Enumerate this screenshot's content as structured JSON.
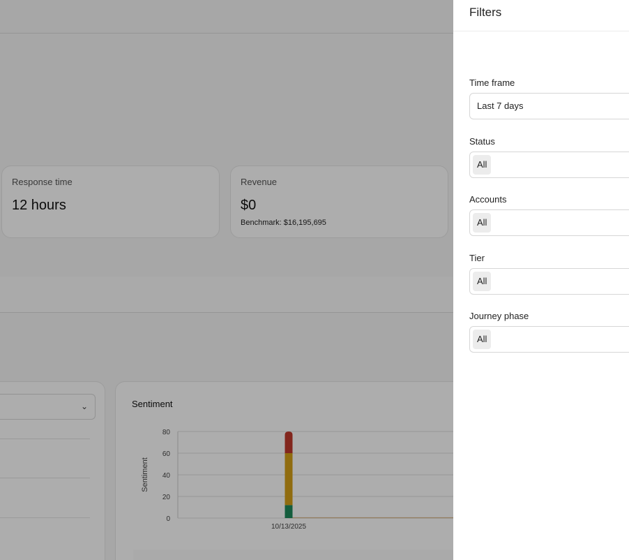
{
  "background": {
    "cards": [
      {
        "title": "Response time",
        "value": "12 hours",
        "sub": ""
      },
      {
        "title": "Revenue",
        "value": "$0",
        "sub": "Benchmark: $16,195,695"
      }
    ],
    "sentiment_chart": {
      "title": "Sentiment",
      "ylabel": "Sentiment"
    }
  },
  "chart_data": {
    "type": "bar",
    "title": "Sentiment",
    "ylabel": "Sentiment",
    "categories": [
      "10/13/2025"
    ],
    "ylim": [
      0,
      80
    ],
    "yticks": [
      "0",
      "20",
      "40",
      "60",
      "80"
    ],
    "stacked": true,
    "series": [
      {
        "color": "#1e8a5a",
        "values": [
          12
        ]
      },
      {
        "color": "#d4a017",
        "values": [
          48
        ]
      },
      {
        "color": "#c0392b",
        "values": [
          20
        ]
      }
    ]
  },
  "filters": {
    "title": "Filters",
    "fields": [
      {
        "label": "Time frame",
        "value": "Last 7 days"
      },
      {
        "label": "Status",
        "value": "All"
      },
      {
        "label": "Accounts",
        "value": "All"
      },
      {
        "label": "Tier",
        "value": "All"
      },
      {
        "label": "Journey phase",
        "value": "All"
      }
    ]
  }
}
